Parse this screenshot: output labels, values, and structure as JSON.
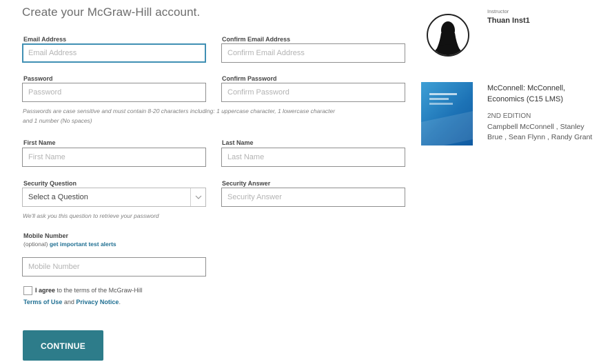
{
  "form": {
    "title": "Create your McGraw-Hill account.",
    "email": {
      "label": "Email Address",
      "placeholder": "Email Address"
    },
    "confirm_email": {
      "label": "Confirm Email Address",
      "placeholder": "Confirm Email Address"
    },
    "password": {
      "label": "Password",
      "placeholder": "Password"
    },
    "confirm_password": {
      "label": "Confirm Password",
      "placeholder": "Confirm Password"
    },
    "password_help_line1": "Passwords are case sensitive and must contain 8-20 characters including: 1 uppercase character, 1 lowercase character",
    "password_help_line2": "and 1 number (No spaces)",
    "first_name": {
      "label": "First Name",
      "placeholder": "First Name"
    },
    "last_name": {
      "label": "Last Name",
      "placeholder": "Last Name"
    },
    "security_question": {
      "label": "Security Question",
      "selected": "Select a Question"
    },
    "security_answer": {
      "label": "Security Answer",
      "placeholder": "Security Answer"
    },
    "security_help": "We'll ask you this question to retrieve your password",
    "mobile": {
      "label": "Mobile Number",
      "optional_prefix": "(optional)",
      "alerts_link": "get important test alerts",
      "placeholder": "Mobile Number"
    },
    "terms": {
      "agree_bold": "I agree",
      "agree_text": " to the terms of the McGraw-Hill",
      "terms_link": "Terms of Use",
      "and_text": " and ",
      "privacy_link": "Privacy Notice",
      "period": "."
    },
    "continue_label": "CONTINUE"
  },
  "instructor": {
    "heading": "Instructor",
    "name": "Thuan Inst1"
  },
  "book": {
    "title_line1": "McConnell: McConnell,",
    "title_line2": "Economics (C15 LMS)",
    "edition": "2ND EDITION",
    "authors_line1": "Campbell McConnell , Stanley",
    "authors_line2": "Brue , Sean Flynn , Randy Grant"
  },
  "colors": {
    "accent": "#2d7c8a",
    "link": "#1f6f92",
    "focus_border": "#3f8fb3"
  }
}
